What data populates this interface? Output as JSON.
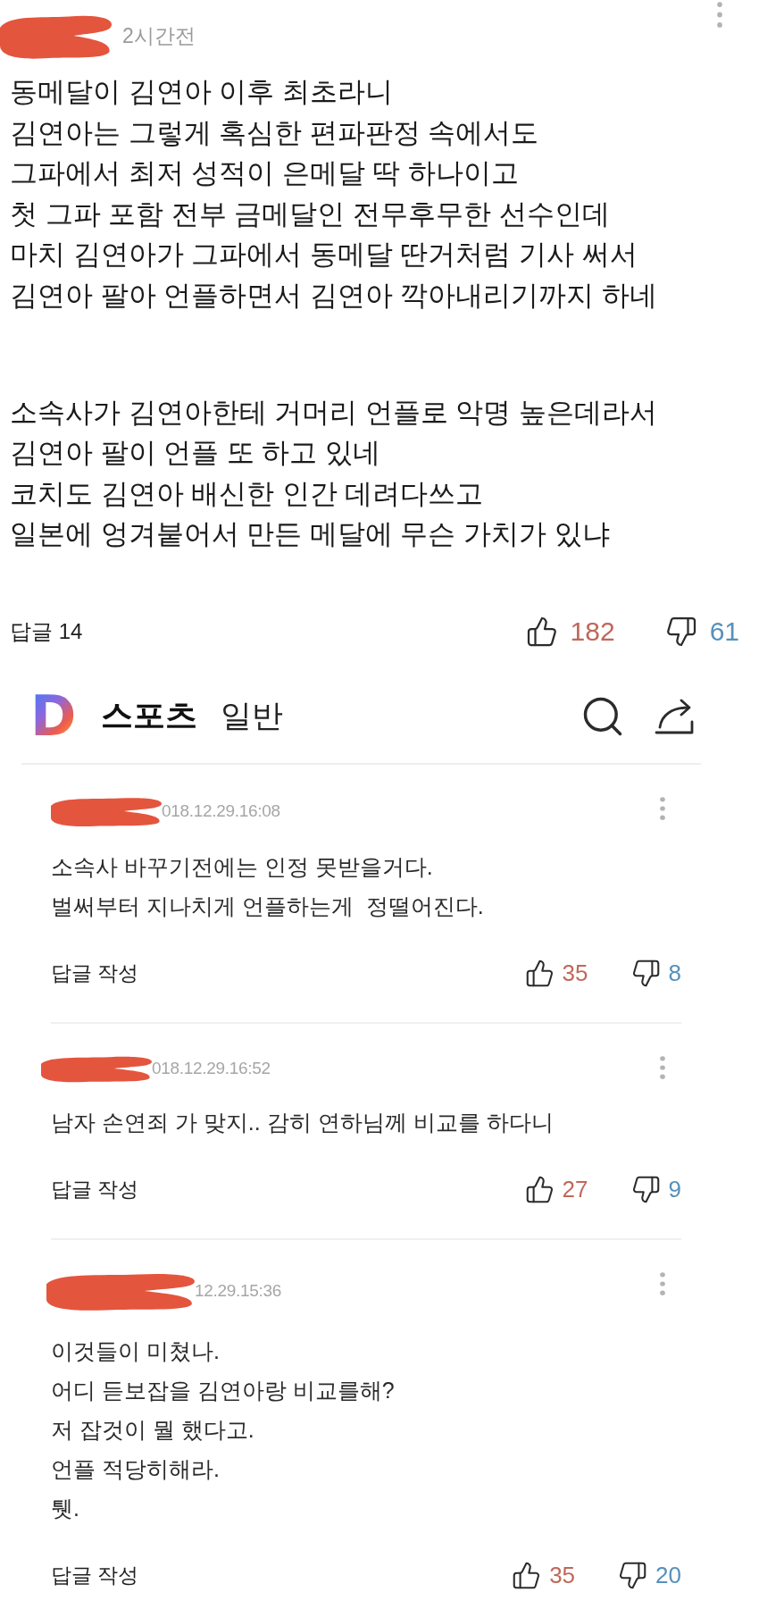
{
  "post": {
    "time": "2시간전",
    "paragraphs": [
      "동메달이 김연아 이후 최초라니\n김연아는 그렇게 혹심한 편파판정 속에서도\n그파에서 최저 성적이 은메달 딱 하나이고\n첫 그파 포함 전부 금메달인 전무후무한 선수인데\n마치 김연아가 그파에서 동메달 딴거처럼 기사 써서\n김연아 팔아 언플하면서 김연아 깍아내리기까지 하네",
      "소속사가 김연아한테 거머리 언플로 악명 높은데라서\n김연아 팔이 언플 또 하고 있네\n코치도 김연아 배신한 인간 데려다쓰고\n일본에 엉겨붙어서 만든 메달에 무슨 가치가 있냐"
    ],
    "replies": "답글 14",
    "likes": "182",
    "dislikes": "61"
  },
  "header": {
    "logo": "D",
    "category": "스포츠",
    "subcategory": "일반"
  },
  "comments": [
    {
      "date": "018.12.29.16:08",
      "text": "소속사 바꾸기전에는 인정 못받을거다.\n벌써부터 지나치게 언플하는게  정떨어진다.",
      "reply_label": "답글 작성",
      "likes": "35",
      "dislikes": "8"
    },
    {
      "date": "018.12.29.16:52",
      "text": "남자 손연죄 가 맞지.. 감히 연하님께 비교를 하다니",
      "reply_label": "답글 작성",
      "likes": "27",
      "dislikes": "9"
    },
    {
      "date": "12.29.15:36",
      "text": "이것들이 미쳤나.\n어디 듣보잡을 김연아랑 비교를해?\n저 잡것이 뭘 했다고.\n언플 적당히해라.\n퉷.",
      "reply_label": "답글 작성",
      "likes": "35",
      "dislikes": "20"
    }
  ]
}
